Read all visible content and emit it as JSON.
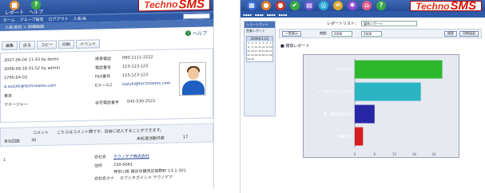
{
  "left": {
    "toolbar": [
      {
        "label": "レポート",
        "icon": "report-icon"
      },
      {
        "label": "ヘルプ",
        "icon": "help-icon"
      }
    ],
    "logo": {
      "text": "Techno",
      "accent": "SMS"
    },
    "nav": [
      "ホーム",
      "グループ設定",
      "ログアウト"
    ],
    "nav_account": "人名/会",
    "crumb": "人名/会社 > 詳細画面",
    "help_label": "ヘルプ",
    "tabs": [
      "編集",
      "戻る",
      "コピー",
      "印刷",
      "イベント"
    ],
    "fields_left": [
      {
        "label": "",
        "value": "2007-06-04 11:43 by demo"
      },
      {
        "label": "",
        "value": "2006-08-18 01:52 by admin"
      },
      {
        "label": "",
        "value": "1795-04-03"
      },
      {
        "label": "",
        "value": "a.suzuki@technosms.com"
      },
      {
        "label": "",
        "value": "東京"
      },
      {
        "label": "",
        "value": "マネージャー"
      }
    ],
    "fields_right": [
      {
        "label": "携帯電話",
        "value": "080-1111-2222"
      },
      {
        "label": "電話番号",
        "value": "123-123-123"
      },
      {
        "label": "FAX番号",
        "value": "123-123-123"
      },
      {
        "label": "Eメール2",
        "value": "suzuki@technosms.com"
      },
      {
        "label": "",
        "value": ""
      },
      {
        "label": "自宅電話番号",
        "value": "045-530-2521"
      }
    ],
    "comment_label": "コメント",
    "comment_text": "こちらはコメント欄です。自由に記入することができます。",
    "count_label": "来社回数",
    "count_value": "30",
    "unfinished_label": "未処理活動件数",
    "unfinished_value": "17",
    "company": {
      "name_label": "会社名",
      "name": "テクノゲア株式会社",
      "address_label": "住所",
      "zip": "230-0061",
      "address": "神奈川県 横浜市鶴見区佃野町 13-1-301",
      "kana_label": "会社名カナ",
      "kana": "カブシキガイシャ テクノゲア"
    }
  },
  "right": {
    "logo": {
      "text": "Techno",
      "accent": "SMS"
    },
    "side_heading": "ショートカット",
    "side_item": "営業レポート",
    "cal_title": "2006年11月",
    "report_list_label": "レポートリスト：",
    "report_list_value": "媒体レポート",
    "filter_btn": "一覧表示",
    "period_label": "期間：",
    "period_start": "2006",
    "period_end": "2006",
    "search_btn": "検索",
    "export_btn": "印刷画面",
    "chart_heading": "媒体レポート"
  },
  "chart_data": {
    "type": "bar",
    "orientation": "horizontal",
    "title": "媒体レポート",
    "categories": [
      "なし(161)",
      "インターネット(191)",
      "新・雑誌広告(16)",
      "新聞(31)"
    ],
    "values": [
      26.5,
      20,
      6,
      2.5
    ],
    "colors": [
      "#2db82d",
      "#2bb4c2",
      "#2727a6",
      "#d61f1f"
    ],
    "xticks": [
      "0",
      "6",
      "12",
      "18",
      "24"
    ],
    "xlim": [
      0,
      30
    ],
    "grid": false
  }
}
